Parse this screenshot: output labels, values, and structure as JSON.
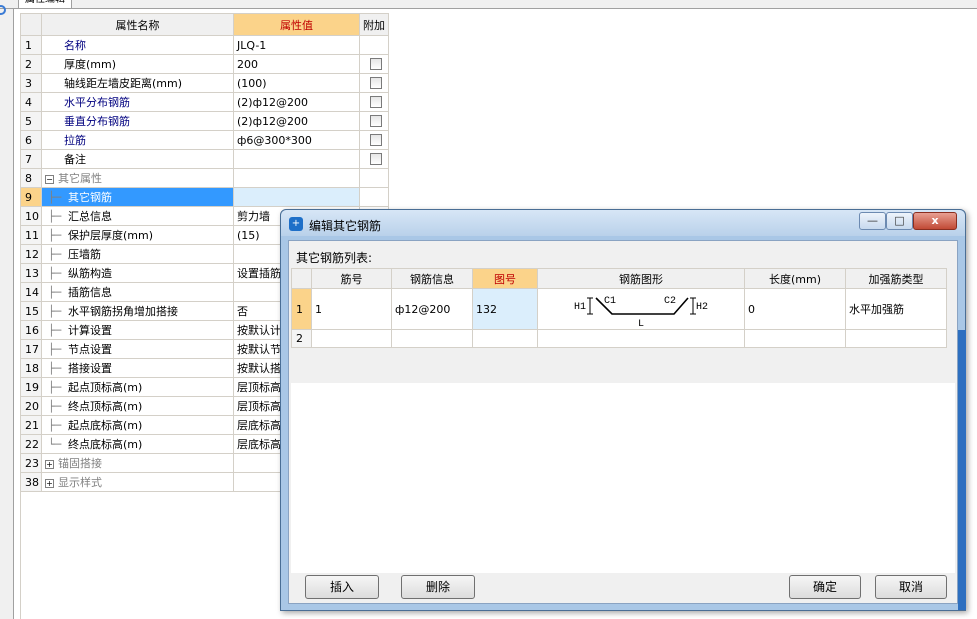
{
  "top_tab": {
    "label": "属性编辑"
  },
  "property_grid": {
    "headers": {
      "name": "属性名称",
      "value": "属性值",
      "extra": "附加"
    },
    "rows": [
      {
        "n": "1",
        "name": "名称",
        "value": "JLQ-1",
        "check": false,
        "style": "link"
      },
      {
        "n": "2",
        "name": "厚度(mm)",
        "value": "200",
        "check": true,
        "style": "plain"
      },
      {
        "n": "3",
        "name": "轴线距左墙皮距离(mm)",
        "value": "(100)",
        "check": true,
        "style": "plain"
      },
      {
        "n": "4",
        "name": "水平分布钢筋",
        "value": "(2)ф12@200",
        "check": true,
        "style": "link"
      },
      {
        "n": "5",
        "name": "垂直分布钢筋",
        "value": "(2)ф12@200",
        "check": true,
        "style": "link"
      },
      {
        "n": "6",
        "name": "拉筋",
        "value": "ф6@300*300",
        "check": true,
        "style": "link"
      },
      {
        "n": "7",
        "name": "备注",
        "value": "",
        "check": true,
        "style": "plain"
      },
      {
        "n": "8",
        "name": "其它属性",
        "value": "",
        "check": false,
        "style": "group",
        "expander": "−"
      },
      {
        "n": "9",
        "name": "其它钢筋",
        "value": "",
        "check": false,
        "style": "selected"
      },
      {
        "n": "10",
        "name": "汇总信息",
        "value": "剪力墙",
        "check": false,
        "style": "child"
      },
      {
        "n": "11",
        "name": "保护层厚度(mm)",
        "value": "(15)",
        "check": false,
        "style": "child"
      },
      {
        "n": "12",
        "name": "压墙筋",
        "value": "",
        "check": false,
        "style": "child"
      },
      {
        "n": "13",
        "name": "纵筋构造",
        "value": "设置插筋",
        "check": false,
        "style": "child"
      },
      {
        "n": "14",
        "name": "插筋信息",
        "value": "",
        "check": false,
        "style": "child"
      },
      {
        "n": "15",
        "name": "水平钢筋拐角增加搭接",
        "value": "否",
        "check": false,
        "style": "child"
      },
      {
        "n": "16",
        "name": "计算设置",
        "value": "按默认计",
        "check": false,
        "style": "child"
      },
      {
        "n": "17",
        "name": "节点设置",
        "value": "按默认节",
        "check": false,
        "style": "child"
      },
      {
        "n": "18",
        "name": "搭接设置",
        "value": "按默认搭",
        "check": false,
        "style": "child"
      },
      {
        "n": "19",
        "name": "起点顶标高(m)",
        "value": "层顶标高",
        "check": false,
        "style": "child"
      },
      {
        "n": "20",
        "name": "终点顶标高(m)",
        "value": "层顶标高",
        "check": false,
        "style": "child"
      },
      {
        "n": "21",
        "name": "起点底标高(m)",
        "value": "层底标高",
        "check": false,
        "style": "child"
      },
      {
        "n": "22",
        "name": "终点底标高(m)",
        "value": "层底标高",
        "check": false,
        "style": "child-last"
      },
      {
        "n": "23",
        "name": "锚固搭接",
        "value": "",
        "check": false,
        "style": "group",
        "expander": "+"
      },
      {
        "n": "38",
        "name": "显示样式",
        "value": "",
        "check": false,
        "style": "group",
        "expander": "+"
      }
    ]
  },
  "dialog": {
    "title": "编辑其它钢筋",
    "list_label": "其它钢筋列表:",
    "columns": [
      "",
      "筋号",
      "钢筋信息",
      "图号",
      "钢筋图形",
      "长度(mm)",
      "加强筋类型"
    ],
    "rows": [
      {
        "n": "1",
        "jin_hao": "1",
        "info": "ф12@200",
        "tu_hao": "132",
        "length": "0",
        "type": "水平加强筋"
      },
      {
        "n": "2",
        "jin_hao": "",
        "info": "",
        "tu_hao": "",
        "length": "",
        "type": ""
      }
    ],
    "shape_labels": {
      "h1": "H1",
      "c1": "C1",
      "c2": "C2",
      "h2": "H2",
      "l": "L"
    },
    "buttons": {
      "insert": "插入",
      "delete": "删除",
      "ok": "确定",
      "cancel": "取消"
    },
    "window_controls": {
      "min": "—",
      "max": "□",
      "close": "x"
    },
    "icon_glyph": "+"
  },
  "colors": {
    "header_highlight": "#fbd38a",
    "header_text_red": "#c00000",
    "selection_blue": "#3399ff",
    "link_text": "#00007f",
    "dialog_frame": "#a9c7e6"
  }
}
